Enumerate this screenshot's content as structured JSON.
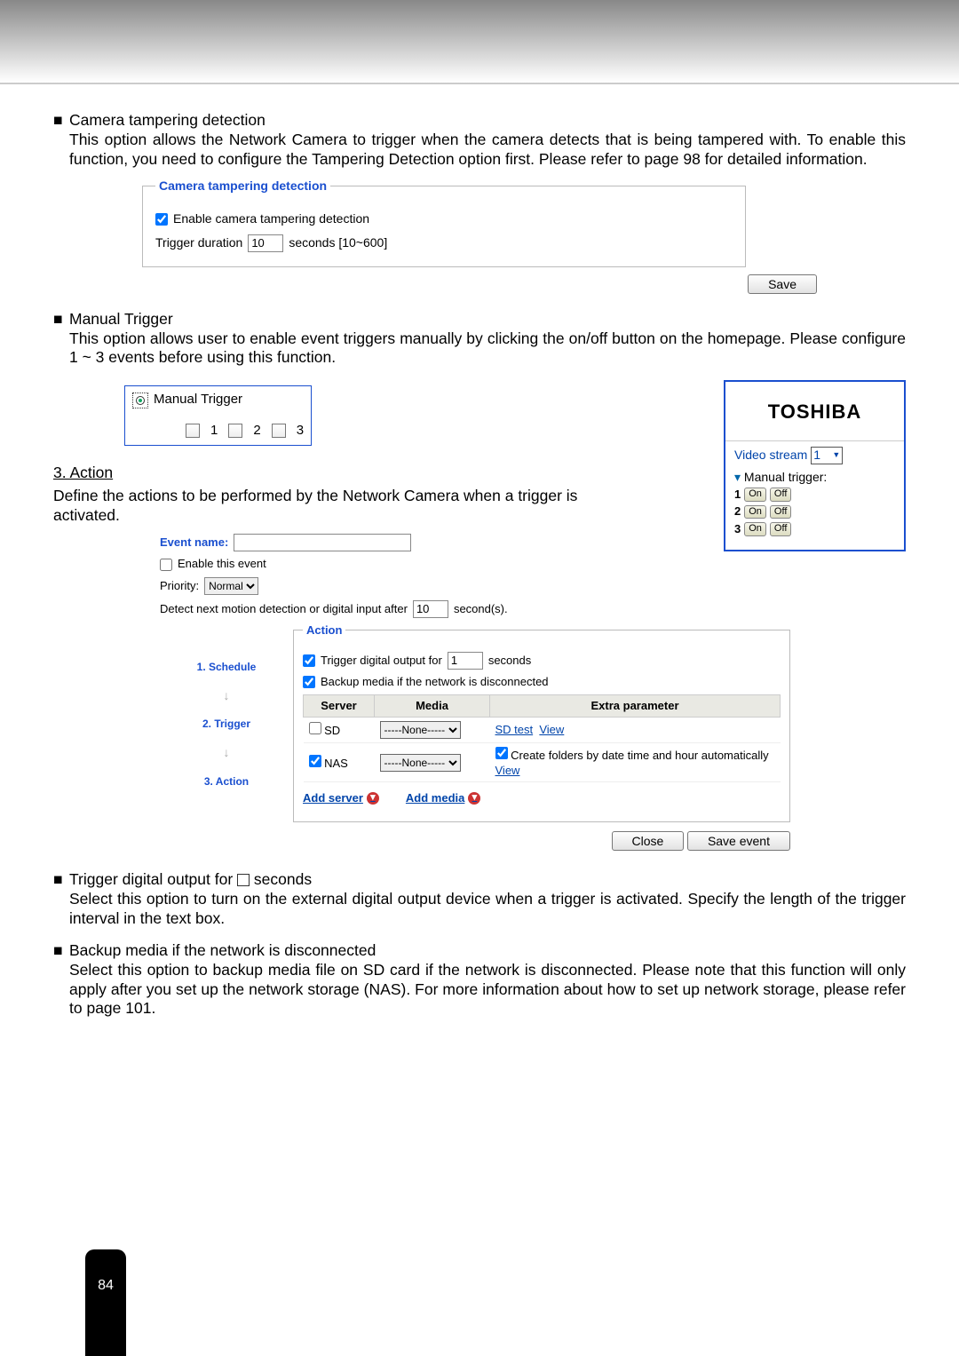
{
  "sec1": {
    "title": "Camera tampering detection",
    "body": "This option allows the Network Camera to trigger when the camera detects that is being tampered with. To enable this function, you need to configure the Tampering Detection option first. Please refer to page 98 for detailed information."
  },
  "ct_panel": {
    "legend": "Camera tampering detection",
    "enable_label": "Enable camera tampering detection",
    "trigdur_label": "Trigger duration",
    "trigdur_value": "10",
    "trigdur_suffix": "seconds [10~600]",
    "save": "Save"
  },
  "sec2": {
    "title": "Manual Trigger",
    "body": "This option allows user to enable event triggers manually by clicking the on/off button on the homepage. Please configure 1 ~ 3 events before using this function."
  },
  "mt_panel": {
    "label": "Manual Trigger",
    "n1": "1",
    "n2": "2",
    "n3": "3"
  },
  "toshiba": {
    "logo": "TOSHIBA",
    "vs_label": "Video stream",
    "vs_value": "1",
    "mt_label": "Manual trigger:",
    "rows": [
      {
        "n": "1",
        "on": "On",
        "off": "Off"
      },
      {
        "n": "2",
        "on": "On",
        "off": "Off"
      },
      {
        "n": "3",
        "on": "On",
        "off": "Off"
      }
    ]
  },
  "action_head": {
    "num": "3. Action",
    "body": "Define the actions to be performed by the Network Camera when a trigger is activated."
  },
  "evt": {
    "name_label": "Event name:",
    "name_value": "",
    "enable_label": "Enable this event",
    "priority_label": "Priority:",
    "priority_value": "Normal",
    "detect_label_pre": "Detect next motion detection or digital input after",
    "detect_value": "10",
    "detect_label_post": "second(s).",
    "steps": {
      "s1": "1.  Schedule",
      "s2": "2.  Trigger",
      "s3": "3.  Action"
    },
    "action_legend": "Action",
    "tdo_label": "Trigger digital output for",
    "tdo_value": "1",
    "tdo_suffix": "seconds",
    "backup_label": "Backup media if the network is disconnected",
    "th_server": "Server",
    "th_media": "Media",
    "th_extra": "Extra parameter",
    "r_sd": "SD",
    "r_none": "-----None-----",
    "r_sdtest": "SD test",
    "r_view": "View",
    "r_nas": "NAS",
    "r_createfolders": "Create folders by date time and hour automatically",
    "add_server": "Add server",
    "add_media": "Add media",
    "close": "Close",
    "save_event": "Save event"
  },
  "sec3": {
    "title_pre": "Trigger digital output for ",
    "title_post": " seconds",
    "body": "Select this option to turn on the external digital output device when a trigger is activated. Specify the length of the trigger interval in the text box."
  },
  "sec4": {
    "title": "Backup media if the network is disconnected",
    "body": "Select this option to backup media file on SD card if the network is disconnected. Please note that this function will only apply after you set up the network storage (NAS). For more information about how to set up network storage, please refer to page 101."
  },
  "page_number": "84"
}
